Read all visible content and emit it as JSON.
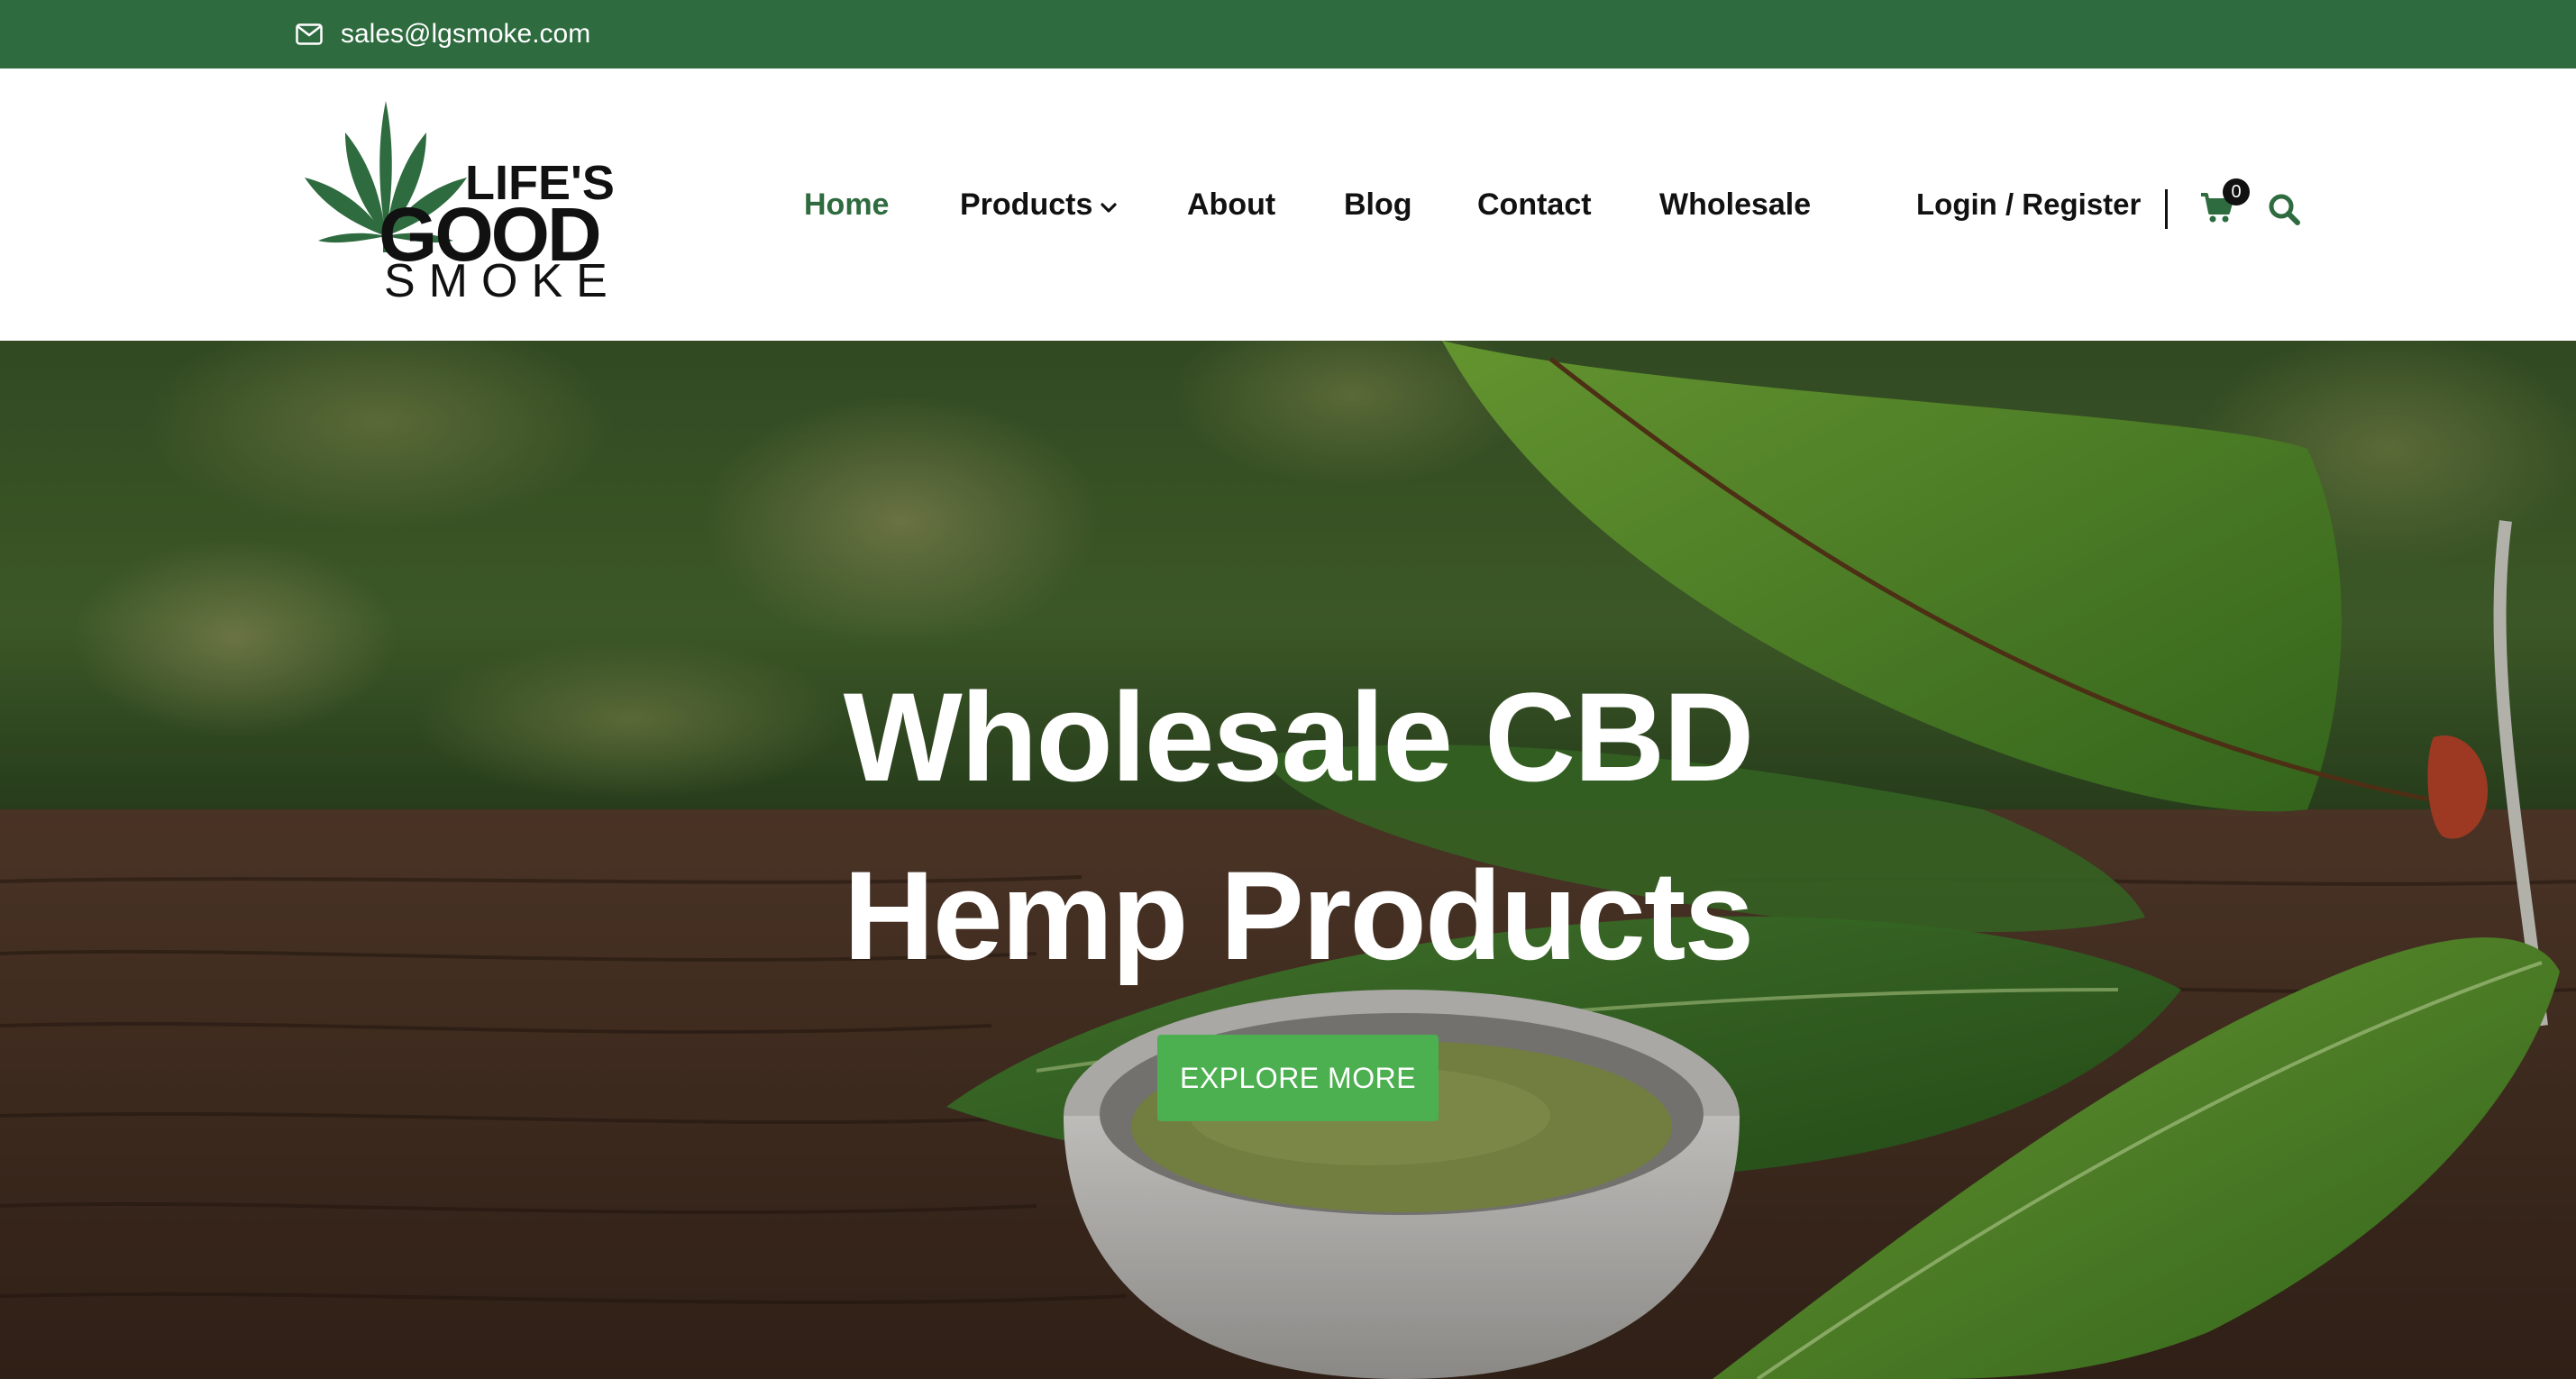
{
  "colors": {
    "brand_green": "#2e6b3f",
    "cta_green": "#4caf50",
    "text_dark": "#111111",
    "white": "#ffffff"
  },
  "topbar": {
    "email": "sales@lgsmoke.com",
    "email_icon": "envelope-icon"
  },
  "logo": {
    "line1": "LIFE'S",
    "line2": "GOOD",
    "line3": "SMOKE",
    "icon": "cannabis-leaf-icon"
  },
  "nav": {
    "items": [
      {
        "label": "Home",
        "active": true
      },
      {
        "label": "Products",
        "has_dropdown": true
      },
      {
        "label": "About"
      },
      {
        "label": "Blog"
      },
      {
        "label": "Contact"
      },
      {
        "label": "Wholesale"
      }
    ],
    "login_label": "Login / Register",
    "cart_count": "0",
    "cart_icon": "shopping-cart-icon",
    "search_icon": "search-icon"
  },
  "hero": {
    "title_line1": "Wholesale CBD",
    "title_line2": "Hemp Products",
    "cta_label": "EXPLORE MORE"
  }
}
